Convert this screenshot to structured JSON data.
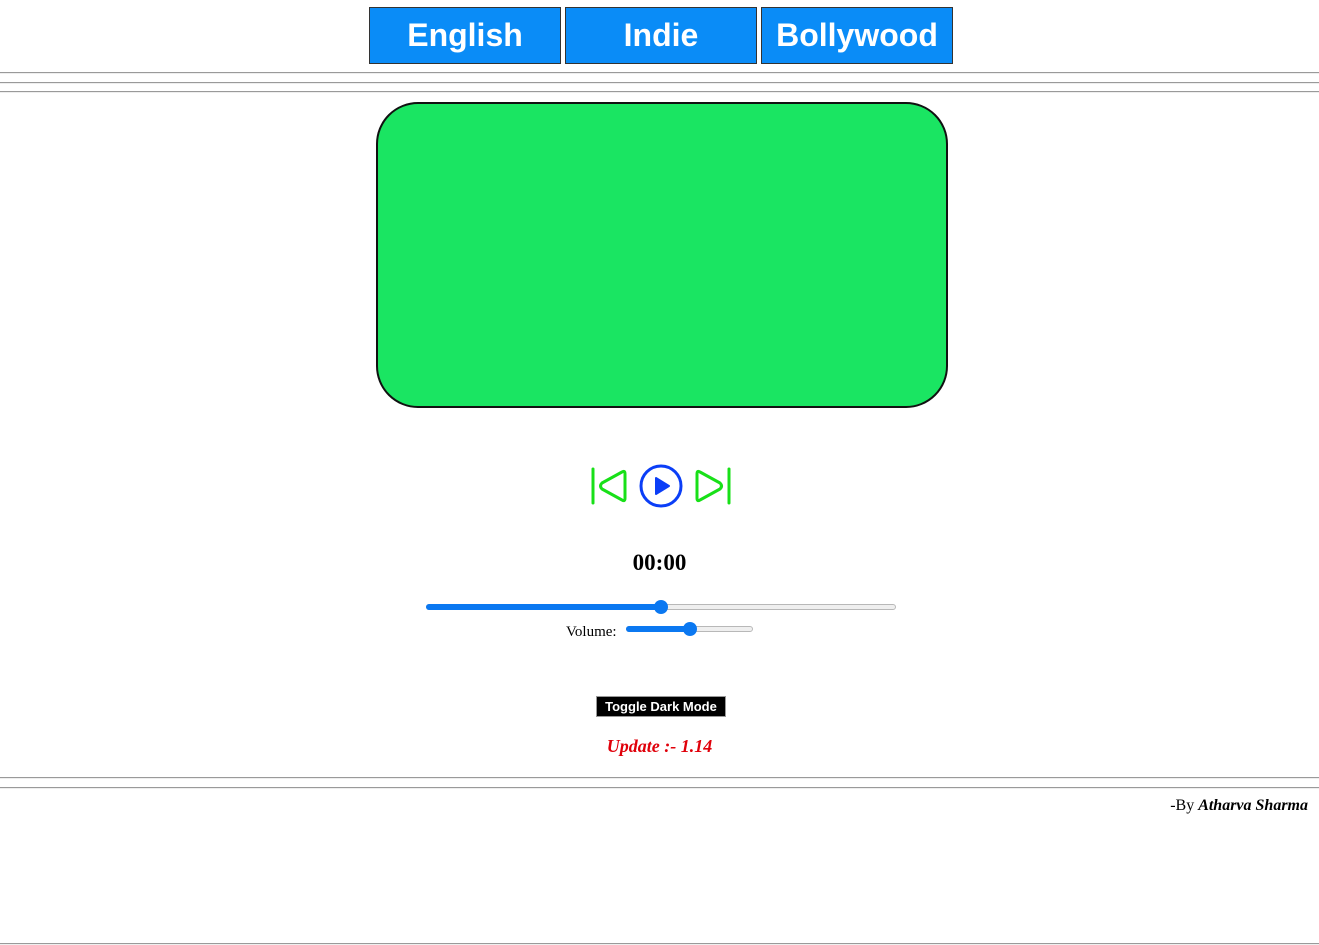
{
  "nav": {
    "items": [
      {
        "label": "English"
      },
      {
        "label": "Indie"
      },
      {
        "label": "Bollywood"
      }
    ]
  },
  "player": {
    "screen_color": "#1ae562",
    "controls": {
      "prev_icon": "skip-back-icon",
      "play_icon": "play-circle-icon",
      "next_icon": "skip-forward-icon",
      "skip_color": "#18e018",
      "play_color": "#0b3ef7"
    },
    "time": "00:00",
    "progress_fraction": 0.5,
    "volume_label": "Volume:",
    "volume_fraction": 0.5
  },
  "toggle_dark_mode_label": "Toggle Dark Mode",
  "update_text": "Update :- 1.14",
  "credit": {
    "prefix": "-By",
    "author": "Atharva Sharma"
  },
  "colors": {
    "nav_bg": "#0a8cf7",
    "accent": "#0b78f1",
    "update_text": "#e0000a"
  }
}
